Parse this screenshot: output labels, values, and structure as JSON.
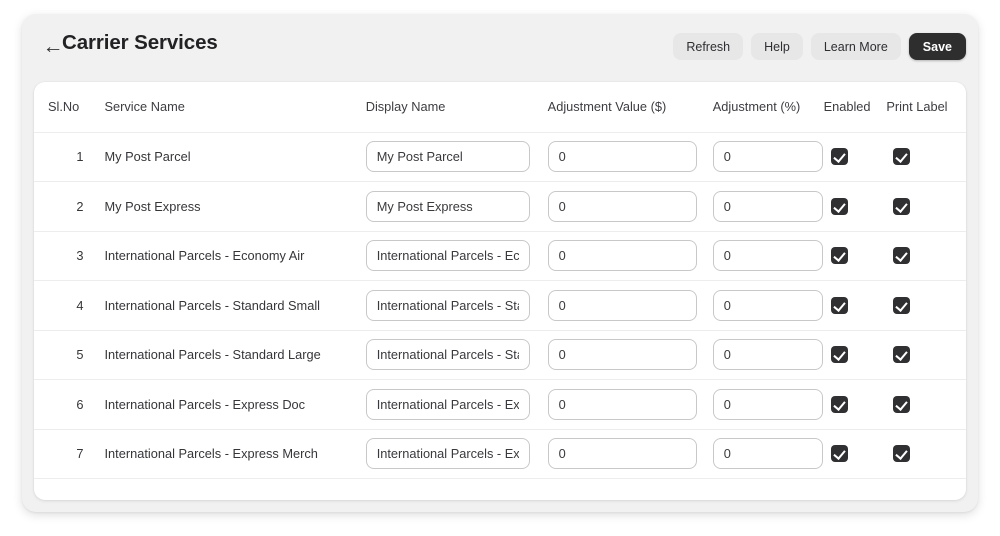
{
  "header": {
    "back_icon": "arrow-left-icon",
    "title": "Carrier Services",
    "actions": [
      {
        "label": "Refresh",
        "name": "refresh-button",
        "style": "secondary"
      },
      {
        "label": "Help",
        "name": "help-button",
        "style": "secondary"
      },
      {
        "label": "Learn More",
        "name": "learn-more-button",
        "style": "secondary"
      },
      {
        "label": "Save",
        "name": "save-button",
        "style": "primary"
      }
    ]
  },
  "table": {
    "columns": [
      "Sl.No",
      "Service Name",
      "Display Name",
      "Adjustment Value ($)",
      "Adjustment (%)",
      "Enabled",
      "Print Label"
    ],
    "rows": [
      {
        "slno": "1",
        "service_name": "My Post Parcel",
        "display_name": "My Post Parcel",
        "adjustment_value": "0",
        "adjustment_percent": "0",
        "enabled": true,
        "print_label": true
      },
      {
        "slno": "2",
        "service_name": "My Post Express",
        "display_name": "My Post Express",
        "adjustment_value": "0",
        "adjustment_percent": "0",
        "enabled": true,
        "print_label": true
      },
      {
        "slno": "3",
        "service_name": "International Parcels - Economy Air",
        "display_name": "International Parcels - Economy Air",
        "adjustment_value": "0",
        "adjustment_percent": "0",
        "enabled": true,
        "print_label": true
      },
      {
        "slno": "4",
        "service_name": "International Parcels - Standard Small",
        "display_name": "International Parcels - Standard Small",
        "adjustment_value": "0",
        "adjustment_percent": "0",
        "enabled": true,
        "print_label": true
      },
      {
        "slno": "5",
        "service_name": "International Parcels - Standard Large",
        "display_name": "International Parcels - Standard Large",
        "adjustment_value": "0",
        "adjustment_percent": "0",
        "enabled": true,
        "print_label": true
      },
      {
        "slno": "6",
        "service_name": "International Parcels - Express Doc",
        "display_name": "International Parcels - Express Doc",
        "adjustment_value": "0",
        "adjustment_percent": "0",
        "enabled": true,
        "print_label": true
      },
      {
        "slno": "7",
        "service_name": "International Parcels - Express Merch",
        "display_name": "International Parcels - Express Merch",
        "adjustment_value": "0",
        "adjustment_percent": "0",
        "enabled": true,
        "print_label": true
      }
    ]
  },
  "colors": {
    "page_background": "#ffffff",
    "shell_background": "#f1f1f1",
    "card_background": "#ffffff",
    "primary_button": "#2e2e2e",
    "secondary_button": "#e7e7e7",
    "checkbox_checked": "#303033",
    "divider": "#ededed",
    "input_border": "#c8c8c8",
    "text": "#36363a"
  }
}
